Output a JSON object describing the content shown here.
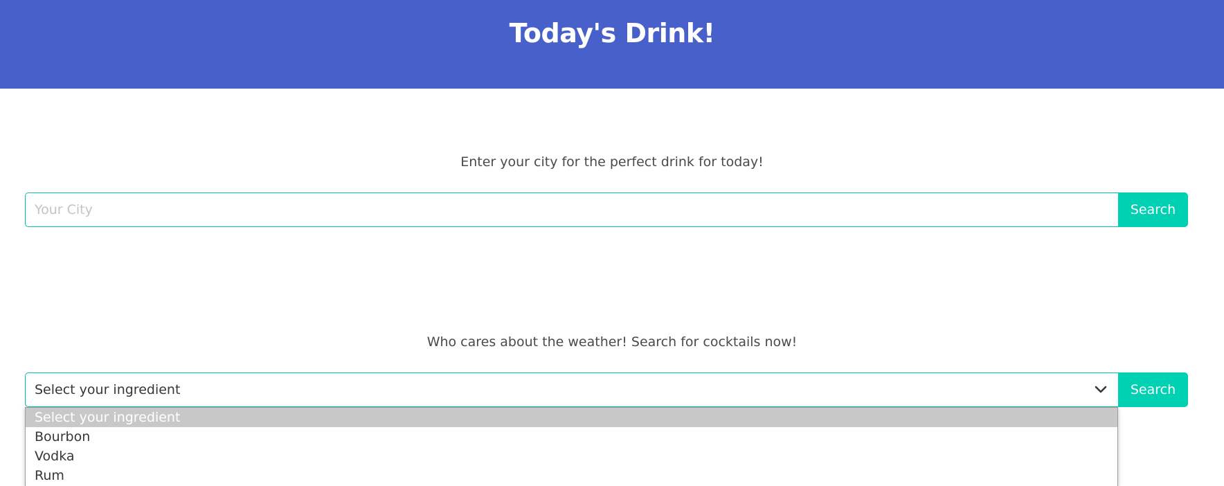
{
  "header": {
    "title": "Today's Drink!",
    "background_color": "#4860c9"
  },
  "city_search": {
    "prompt": "Enter your city for the perfect drink for today!",
    "input_placeholder": "Your City",
    "input_value": "",
    "button_label": "Search"
  },
  "cocktail_search": {
    "prompt": "Who cares about the weather! Search for cocktails now!",
    "select_value": "Select your ingredient",
    "button_label": "Search",
    "dropdown_open": true,
    "options": [
      {
        "label": "Select your ingredient",
        "selected": true
      },
      {
        "label": "Bourbon",
        "selected": false
      },
      {
        "label": "Vodka",
        "selected": false
      },
      {
        "label": "Rum",
        "selected": false
      }
    ]
  },
  "colors": {
    "accent": "#00d1b2",
    "border": "#00c4a7",
    "text": "#4a4a4a"
  },
  "icons": {
    "select_arrow": "chevron-down-icon"
  }
}
